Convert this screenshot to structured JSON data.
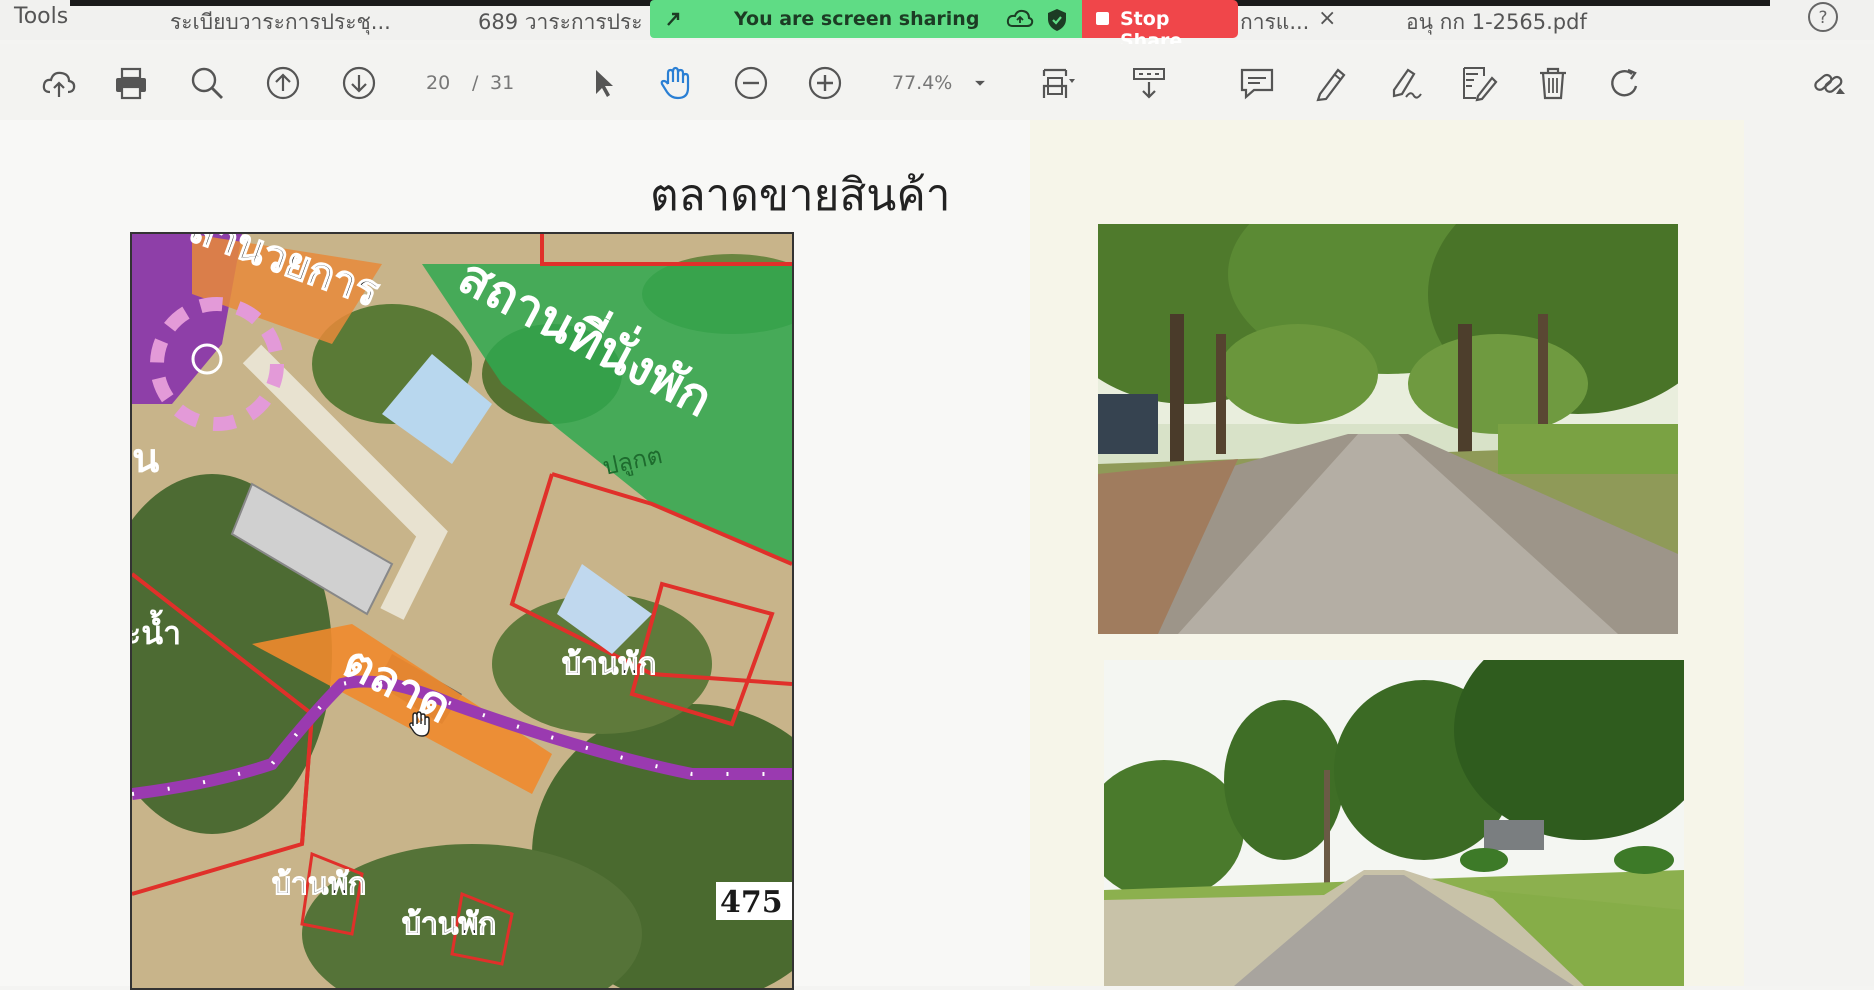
{
  "top": {
    "tools_label": "Tools",
    "tabs": [
      {
        "label": "ระเบียบวาระการประชุ..."
      },
      {
        "label": "689  วาระการประ"
      },
      {
        "label": "การแ..."
      },
      {
        "label": "อนุ กก 1-2565.pdf"
      }
    ],
    "close_glyph": "×"
  },
  "share": {
    "status": "You are screen sharing",
    "stop_label": "Stop Share",
    "colors": {
      "share_bg": "#5fdc85",
      "stop_bg": "#f0464a"
    }
  },
  "toolbar": {
    "page_current": "20",
    "page_separator": "/",
    "page_total": "31",
    "zoom": "77.4%",
    "icons": [
      "upload-icon",
      "print-icon",
      "search-icon",
      "page-up-icon",
      "page-down-icon",
      "select-icon",
      "hand-icon",
      "zoom-out-icon",
      "zoom-in-icon",
      "zoom-dropdown-icon",
      "fit-page-icon",
      "scroll-mode-icon",
      "comment-icon",
      "highlight-icon",
      "sign-icon",
      "edit-icon",
      "delete-icon",
      "rotate-icon",
      "link-icon",
      "help-icon"
    ]
  },
  "document": {
    "title": "ตลาดขายสินค้า",
    "map_labels": {
      "top_area": "ลำนวยการ",
      "green_area": "สถานที่นั่งพัก",
      "green_sub": "ปลูกต",
      "left_1": "น",
      "left_2": "ะน้ำ",
      "market": "ตลาด",
      "house_1": "บ้านพัก",
      "house_2": "บ้านพัก",
      "house_3": "บ้านพัก",
      "route_number": "475"
    }
  }
}
